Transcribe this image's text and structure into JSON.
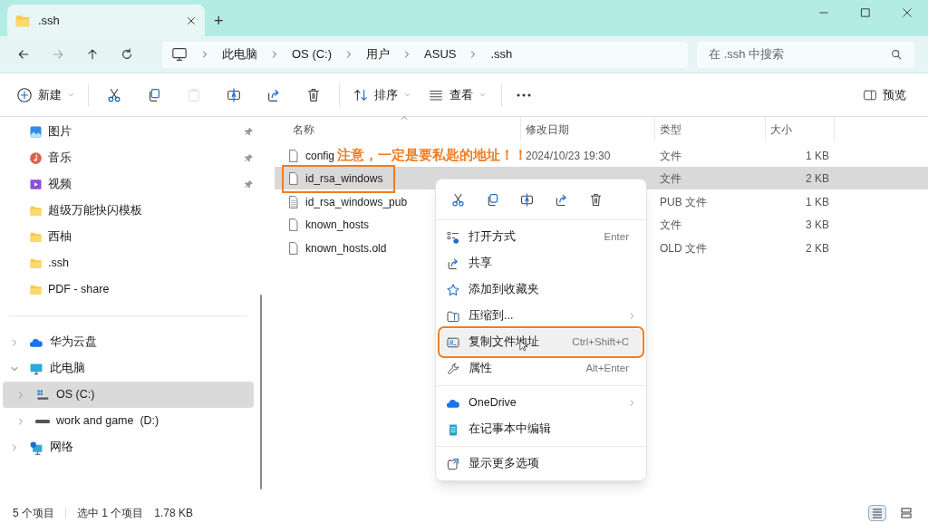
{
  "tab": {
    "title": ".ssh",
    "new_tab": "+"
  },
  "address": {
    "breadcrumbs": [
      "此电脑",
      "OS (C:)",
      "用户",
      "ASUS",
      ".ssh"
    ]
  },
  "search": {
    "placeholder": "在 .ssh 中搜索"
  },
  "toolbar": {
    "new": "新建",
    "sort": "排序",
    "view": "查看",
    "preview": "预览",
    "actions": [
      {
        "kind": "cut",
        "disabled": false
      },
      {
        "kind": "copy",
        "disabled": false
      },
      {
        "kind": "paste",
        "disabled": true
      },
      {
        "kind": "rename",
        "disabled": false
      },
      {
        "kind": "share",
        "disabled": false
      },
      {
        "kind": "delete",
        "disabled": false
      }
    ]
  },
  "sidebar": {
    "quick_access": [
      {
        "label": "图片",
        "kind": "pictures",
        "pinned": true
      },
      {
        "label": "音乐",
        "kind": "music",
        "pinned": true
      },
      {
        "label": "视频",
        "kind": "video",
        "pinned": true
      },
      {
        "label": "超级万能快闪模板",
        "kind": "folder",
        "pinned": false
      },
      {
        "label": "西柚",
        "kind": "folder",
        "pinned": false
      },
      {
        "label": ".ssh",
        "kind": "folder",
        "pinned": false
      },
      {
        "label": "PDF - share",
        "kind": "folder",
        "pinned": false
      }
    ],
    "locations": [
      {
        "label": "华为云盘",
        "kind": "cloud",
        "expanded": false,
        "selected": false
      },
      {
        "label": "此电脑",
        "kind": "pc",
        "expanded": true,
        "selected": false,
        "children": [
          {
            "label": "OS (C:)",
            "kind": "windows-drive",
            "expanded": false,
            "selected": true
          },
          {
            "label": "work and game  (D:)",
            "kind": "drive",
            "expanded": false,
            "selected": false
          }
        ]
      },
      {
        "label": "网络",
        "kind": "network",
        "expanded": false,
        "selected": false
      }
    ]
  },
  "table": {
    "columns": [
      "名称",
      "修改日期",
      "类型",
      "大小"
    ],
    "rows": [
      {
        "name": "config",
        "kind": "file",
        "date": "2024/10/23 19:30",
        "type": "文件",
        "size": "1 KB",
        "selected": false,
        "annotated": false
      },
      {
        "name": "id_rsa_windows",
        "kind": "file",
        "type": "文件",
        "size": "2 KB",
        "selected": true,
        "annotated": true
      },
      {
        "name": "id_rsa_windows_pub",
        "kind": "text-file",
        "type": "PUB 文件",
        "size": "1 KB",
        "selected": false,
        "annotated": false
      },
      {
        "name": "known_hosts",
        "kind": "file",
        "type": "文件",
        "size": "3 KB",
        "selected": false,
        "annotated": false
      },
      {
        "name": "known_hosts.old",
        "kind": "file",
        "type": "OLD 文件",
        "size": "2 KB",
        "selected": false,
        "annotated": false
      }
    ]
  },
  "annotation": {
    "note": "注意，一定是要私匙的地址！！"
  },
  "context_menu": {
    "quick_actions": [
      {
        "kind": "cut"
      },
      {
        "kind": "copy"
      },
      {
        "kind": "rename"
      },
      {
        "kind": "share"
      },
      {
        "kind": "delete"
      }
    ],
    "groups": [
      [
        {
          "label": "打开方式",
          "shortcut": "Enter",
          "kind": "open-with",
          "submenu": false,
          "selected": false,
          "annotated": false
        },
        {
          "label": "共享",
          "kind": "share",
          "submenu": false,
          "selected": false,
          "annotated": false
        },
        {
          "label": "添加到收藏夹",
          "kind": "star",
          "submenu": false,
          "selected": false,
          "annotated": false
        },
        {
          "label": "压缩到...",
          "kind": "zip",
          "submenu": true,
          "selected": false,
          "annotated": false
        },
        {
          "label": "复制文件地址",
          "shortcut": "Ctrl+Shift+C",
          "kind": "copy-path",
          "submenu": false,
          "selected": true,
          "annotated": true
        },
        {
          "label": "属性",
          "shortcut": "Alt+Enter",
          "kind": "wrench",
          "submenu": false,
          "selected": false,
          "annotated": false
        }
      ],
      [
        {
          "label": "OneDrive",
          "kind": "cloud",
          "submenu": true,
          "selected": false,
          "annotated": false
        },
        {
          "label": "在记事本中编辑",
          "kind": "notepad",
          "submenu": false,
          "selected": false,
          "annotated": false
        }
      ],
      [
        {
          "label": "显示更多选项",
          "kind": "more",
          "submenu": false,
          "selected": false,
          "annotated": false
        }
      ]
    ]
  },
  "status_bar": {
    "count": "5 个项目",
    "selection": "选中 1 个项目",
    "size": "1.78 KB"
  }
}
